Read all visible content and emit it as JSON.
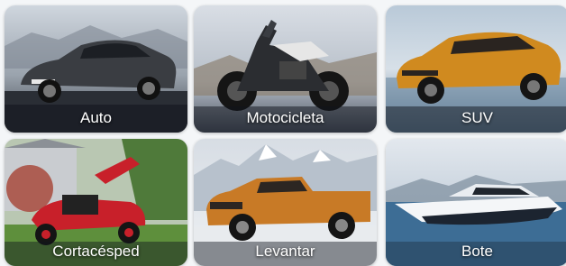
{
  "vehicle_options": [
    {
      "label": "Auto"
    },
    {
      "label": "Motocicleta"
    },
    {
      "label": "SUV"
    },
    {
      "label": "Cortacésped"
    },
    {
      "label": "Levantar"
    },
    {
      "label": "Bote"
    }
  ],
  "colors": {
    "label_text": "#ffffff",
    "car_body": "#3a3d42",
    "suv_body": "#d08a1f",
    "pickup_body": "#c87a26",
    "mower_body": "#c8202a",
    "boat_hull": "#f4f6f8"
  },
  "icons": {
    "auto": "sports-car-image",
    "motocicleta": "motorcycle-image",
    "suv": "suv-image",
    "cortacesped": "lawn-mower-image",
    "levantar": "pickup-truck-image",
    "bote": "yacht-image"
  }
}
